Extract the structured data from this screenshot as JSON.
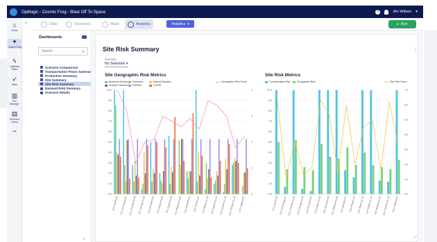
{
  "app": {
    "title": "Optilogic - Cosmic Frog - Blast Off To Space",
    "user": "Jim Wilson"
  },
  "rail": [
    {
      "label": "Home",
      "icon": "home-icon",
      "glyph": "⌂",
      "active": false
    },
    {
      "label": "Cosmic Frog",
      "icon": "frog-icon",
      "glyph": "✦",
      "active": true
    },
    {
      "label": "Lightning Editor",
      "icon": "lightning-icon",
      "glyph": "ϟ",
      "active": false
    },
    {
      "label": "Atlas",
      "icon": "rocket-icon",
      "glyph": "➶",
      "active": false
    },
    {
      "label": "Run Manager",
      "icon": "run-manager-icon",
      "glyph": "▥",
      "active": false
    },
    {
      "label": "Resource Library",
      "icon": "library-icon",
      "glyph": "▤",
      "active": false
    },
    {
      "label": "",
      "icon": "more-icon",
      "glyph": "•••",
      "active": false
    }
  ],
  "tabs": [
    {
      "label": "Data",
      "active": false
    },
    {
      "label": "Scenarios",
      "active": false
    },
    {
      "label": "Maps",
      "active": false
    },
    {
      "label": "Analytics",
      "active": true
    }
  ],
  "analytics_dropdown": "Analytics",
  "run_label": "Run",
  "dashboards": {
    "title": "Dashboards",
    "search_placeholder": "Search",
    "items": [
      "Scenario Comparison",
      "Transportation Flows Summary",
      "Production Summary",
      "Site Summary",
      "Site Risk Summary",
      "Demand Risk Summary",
      "Scenario Details"
    ],
    "selected_index": 4
  },
  "page": {
    "title": "Site Risk Summary",
    "scenario_label": "Scenario",
    "scenario_value": "No Selection"
  },
  "colors": {
    "business_distance": "#4fc3e0",
    "economic": "#7ad17a",
    "natural_disaster": "#f2c94c",
    "nuclear_distance": "#8e6a4a",
    "political": "#9b8cf0",
    "covid": "#f06a3a",
    "geo_risk_score": "#f596b4",
    "concentration": "#4fc3e0",
    "geographic": "#7ad17a",
    "site_risk_score": "#f2c94c"
  },
  "chart_data": [
    {
      "type": "bar",
      "title": "Site Geographic Risk Metrics",
      "categories": [
        "ExC-Joel-Ex(3)",
        "ExC-Anchorage-Ex",
        "ExC-Charlotte-Ex(3)",
        "ExC-Chicago-Ex(3)",
        "ExC-Cleveland-Ex",
        "ExC-Dayton-Ex(3)",
        "ExC-Detroit-Ex(3)",
        "ExC-Madison-Ex(3)",
        "ExC-Memphis-Ex",
        "ExC-Phoenix-Ex",
        "ExC-Miami-Ex-(3)",
        "ExC-Mobile-Ex-(3)",
        "ExC-Newark-Ex-(3)",
        "ExC-Portland-Ex-(3)",
        "ExC-Oakland-Ex"
      ],
      "ylim_left": [
        0,
        10
      ],
      "ylim_right": [
        0,
        4
      ],
      "yticks_left": [
        "0.0",
        "1.0",
        "2.0",
        "3.0",
        "4.0",
        "5.0",
        "6.0",
        "7.0",
        "8.0",
        "9.0",
        "10.0"
      ],
      "yticks_right": [
        "0",
        "1",
        "2",
        "3",
        "4"
      ],
      "series": [
        {
          "name": "Business Distance",
          "values": [
            10.0,
            10.0,
            2.8,
            0.5,
            5.0,
            2.0,
            5.6,
            0.0,
            2.2,
            10.0,
            0.5,
            1.0,
            0.2,
            2.8,
            0.0
          ]
        },
        {
          "name": "Economic",
          "values": [
            8.5,
            2.8,
            1.2,
            1.0,
            1.2,
            1.3,
            1.0,
            5.2,
            1.5,
            1.2,
            3.0,
            1.3,
            1.0,
            3.0,
            0.8
          ]
        },
        {
          "name": "Natural Disaster",
          "values": [
            4.0,
            1.2,
            3.2,
            4.0,
            2.4,
            1.0,
            2.6,
            2.8,
            2.2,
            4.0,
            1.5,
            2.2,
            3.4,
            3.5,
            2.0
          ]
        },
        {
          "name": "Nuclear Distance",
          "values": [
            3.8,
            5.2,
            1.8,
            2.0,
            2.0,
            2.2,
            2.1,
            5.3,
            2.2,
            1.8,
            2.4,
            1.8,
            2.4,
            3.2,
            2.1
          ]
        },
        {
          "name": "Political",
          "values": [
            5.3,
            5.3,
            5.3,
            5.3,
            5.3,
            5.3,
            5.3,
            5.3,
            5.3,
            5.3,
            5.3,
            5.3,
            5.3,
            5.3,
            5.3
          ]
        },
        {
          "name": "COVID",
          "values": [
            3.6,
            1.5,
            1.6,
            4.7,
            5.0,
            4.5,
            7.4,
            3.2,
            7.8,
            3.7,
            1.6,
            3.2,
            4.8,
            3.0,
            2.5
          ]
        }
      ],
      "line_series": {
        "name": "Geographic Risk Score",
        "axis": "right",
        "values": [
          4.0,
          3.2,
          1.2,
          2.0,
          2.1,
          3.0,
          2.8,
          2.6,
          2.9,
          2.5,
          3.6,
          3.4,
          3.0,
          1.8,
          2.2
        ]
      }
    },
    {
      "type": "bar",
      "title": "Site Risk Metrics",
      "categories": [
        "ExC-Joel-Ex(3)",
        "ExC-Anchorage-Ex",
        "ExC-Charlotte-Ex(3)",
        "ExC-Chicago-Ex(3)",
        "ExC-Cleveland-Ex",
        "ExC-Dayton-Ex(3)",
        "ExC-Detroit-Ex(3)",
        "ExC-Madison-Ex(3)",
        "ExC-Memphis-Ex",
        "ExC-Phoenix-Ex",
        "ExC-Miami-Ex-(3)",
        "ExC-Mobile-Ex-(3)",
        "ExC-Newark-Ex-(3)",
        "ExC-Portland-Ex-(3)",
        "ExC-Oakland-Ex"
      ],
      "ylim_left": [
        0,
        10
      ],
      "ylim_right": [
        0,
        7
      ],
      "yticks_left": [
        "0.0",
        "1.0",
        "2.0",
        "3.0",
        "4.0",
        "5.0",
        "6.0",
        "7.0",
        "8.0",
        "9.0",
        "10.0"
      ],
      "yticks_right": [
        "0.0",
        "1.0",
        "2.0",
        "3.0",
        "4.0",
        "5.0",
        "6.0",
        "7.0"
      ],
      "series": [
        {
          "name": "Concentration Risk",
          "values": [
            10.0,
            0.7,
            10.0,
            0.5,
            0.3,
            10.0,
            10.0,
            10.0,
            2.3,
            1.6,
            10.0,
            10.0,
            1.3,
            1.2,
            10.0
          ]
        },
        {
          "name": "Geographic Risk",
          "values": [
            5.0,
            2.4,
            5.2,
            2.6,
            2.3,
            4.8,
            3.6,
            3.4,
            4.5,
            2.8,
            4.0,
            2.8,
            2.6,
            2.4,
            3.3
          ]
        }
      ],
      "line_series": {
        "name": "Site Risk Score",
        "axis": "right",
        "values": [
          6.2,
          1.0,
          3.6,
          1.3,
          1.8,
          6.3,
          5.4,
          1.4,
          6.0,
          2.0,
          4.5,
          5.0,
          1.6,
          6.2,
          3.4
        ]
      }
    }
  ]
}
